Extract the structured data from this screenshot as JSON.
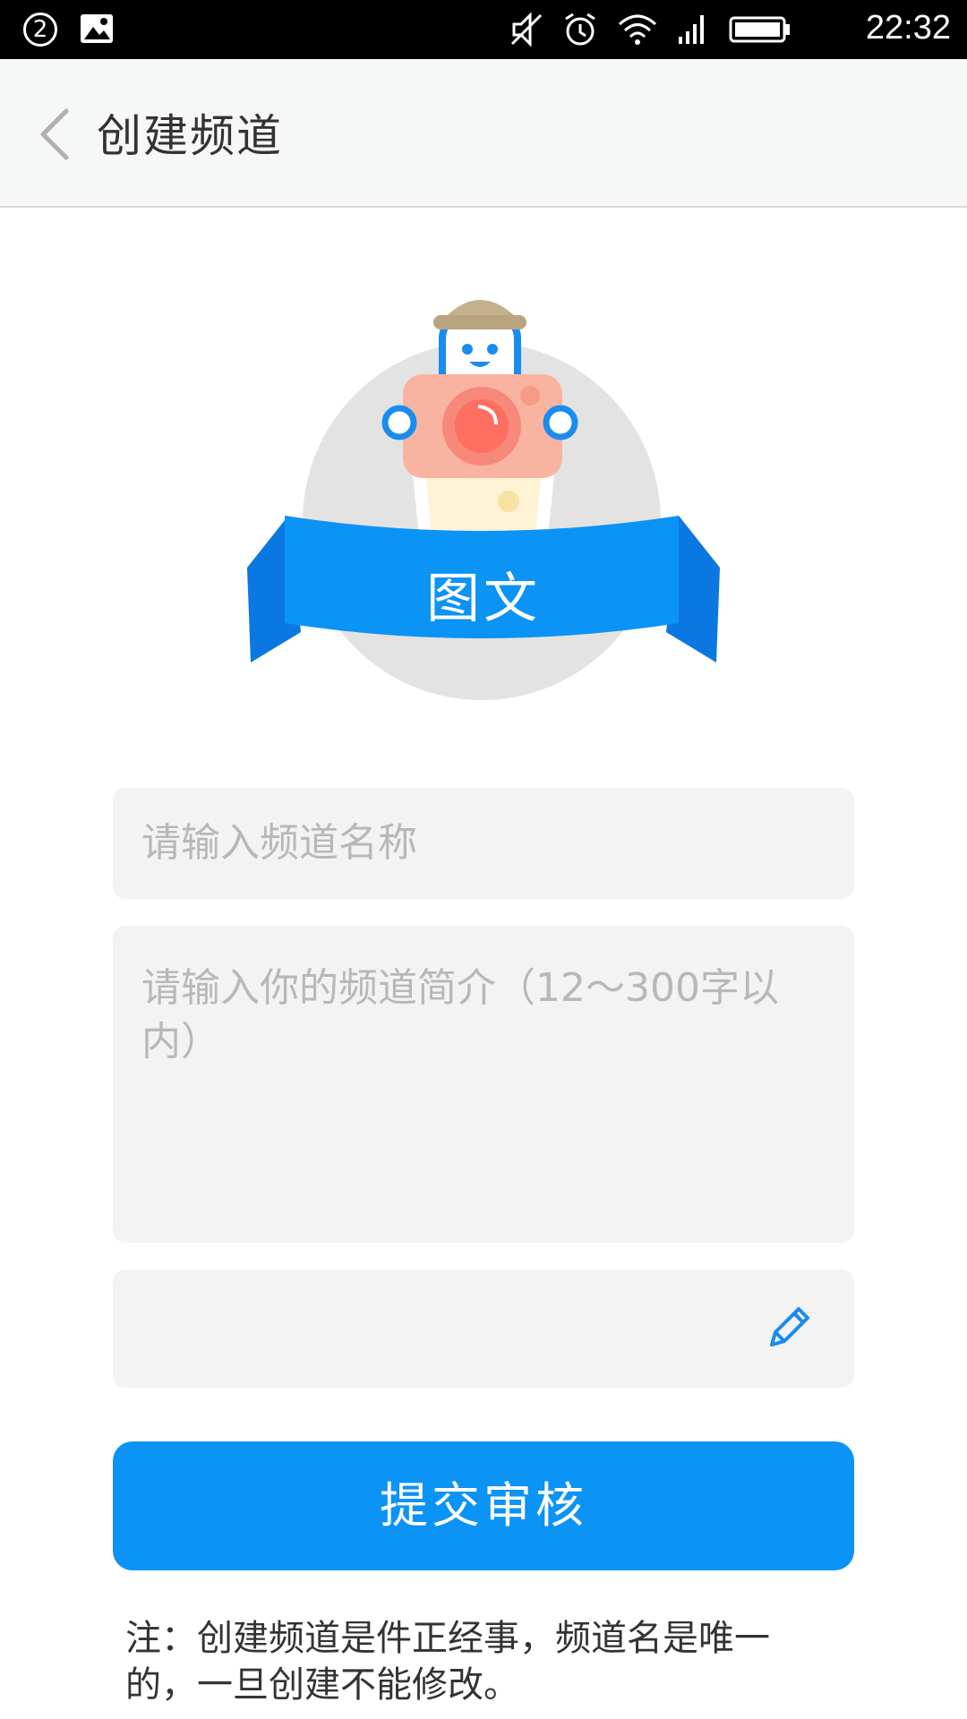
{
  "status_bar": {
    "notification_count": "2",
    "time": "22:32",
    "icons": [
      "image-icon",
      "mute-icon",
      "alarm-icon",
      "wifi-icon",
      "signal-icon",
      "battery-icon"
    ]
  },
  "nav": {
    "back_icon": "chevron-left-icon",
    "title": "创建频道"
  },
  "badge": {
    "label": "图文",
    "colors": {
      "ribbon": "#0b93f6",
      "camera": "#f9b3a1",
      "circle": "#e3e3e3"
    }
  },
  "form": {
    "name_placeholder": "请输入频道名称",
    "intro_placeholder": "请输入你的频道简介（12～300字以内）",
    "extra_icon": "pencil-icon"
  },
  "submit_label": "提交审核",
  "note": "注：创建频道是件正经事，频道名是唯一的，一旦创建不能修改。",
  "colors": {
    "accent": "#0b93f6",
    "field_bg": "#f3f3f3",
    "placeholder": "#b8b8b8"
  }
}
